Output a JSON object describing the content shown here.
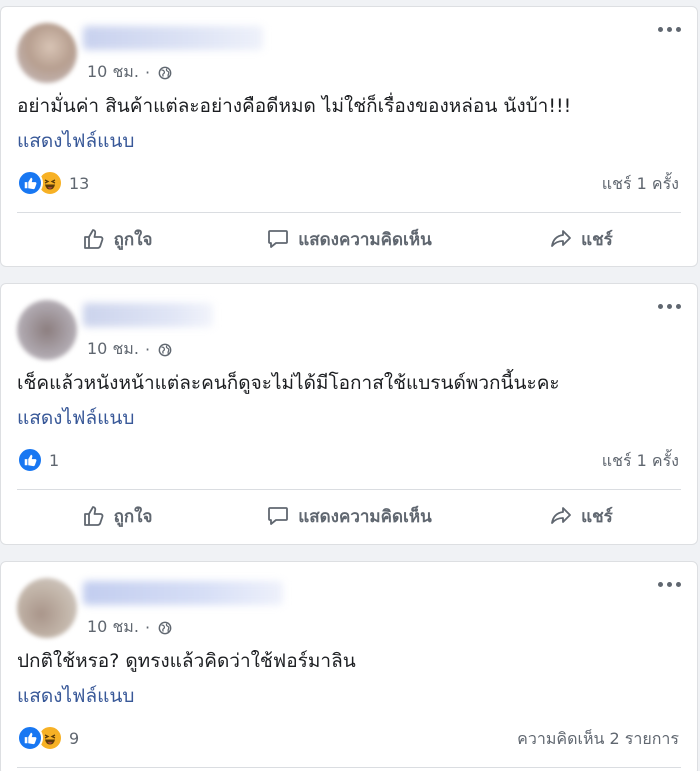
{
  "posts": [
    {
      "time": "10 ชม.",
      "separator": "·",
      "body": "อย่ามั่นค่า สินค้าแต่ละอย่างคือดีหมด ไม่ใช่ก็เรื่องของหล่อน นังบ้า!!!",
      "translate_link": "แสดงไฟล์แนบ",
      "reaction_count": "13",
      "reactions": [
        "like-icon",
        "haha-icon"
      ],
      "right_count": "แชร์ 1 ครั้ง"
    },
    {
      "time": "10 ชม.",
      "separator": "·",
      "body": "เช็คแล้วหนังหน้าแต่ละคนก็ดูจะไม่ได้มีโอกาสใช้แบรนด์พวกนี้นะคะ",
      "translate_link": "แสดงไฟล์แนบ",
      "reaction_count": "1",
      "reactions": [
        "like-icon"
      ],
      "right_count": "แชร์ 1 ครั้ง"
    },
    {
      "time": "10 ชม.",
      "separator": "·",
      "body": "ปกติใช้หรอ? ดูทรงแล้วคิดว่าใช้ฟอร์มาลิน",
      "translate_link": "แสดงไฟล์แนบ",
      "reaction_count": "9",
      "reactions": [
        "like-icon",
        "haha-icon"
      ],
      "right_count": "ความคิดเห็น 2 รายการ"
    }
  ],
  "actions": {
    "like": "ถูกใจ",
    "comment": "แสดงความคิดเห็น",
    "share": "แชร์"
  },
  "colors": {
    "link": "#385898",
    "like_blue": "#1877f2",
    "haha_yellow": "#f7b125",
    "secondary_text": "#606770",
    "background": "#f0f2f5"
  }
}
